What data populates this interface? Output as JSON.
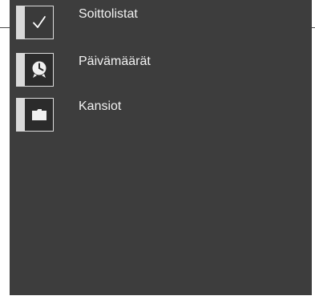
{
  "menu": {
    "items": [
      {
        "label": "Soittolistat",
        "icon": "checkmark-icon",
        "selected": true
      },
      {
        "label": "Päivämäärät",
        "icon": "clock-icon",
        "selected": false
      },
      {
        "label": "Kansiot",
        "icon": "folder-icon",
        "selected": false
      }
    ]
  },
  "colors": {
    "panel_background": "#3d3d3d",
    "text": "#f2f2f2",
    "tab": "#d9d9d9"
  }
}
